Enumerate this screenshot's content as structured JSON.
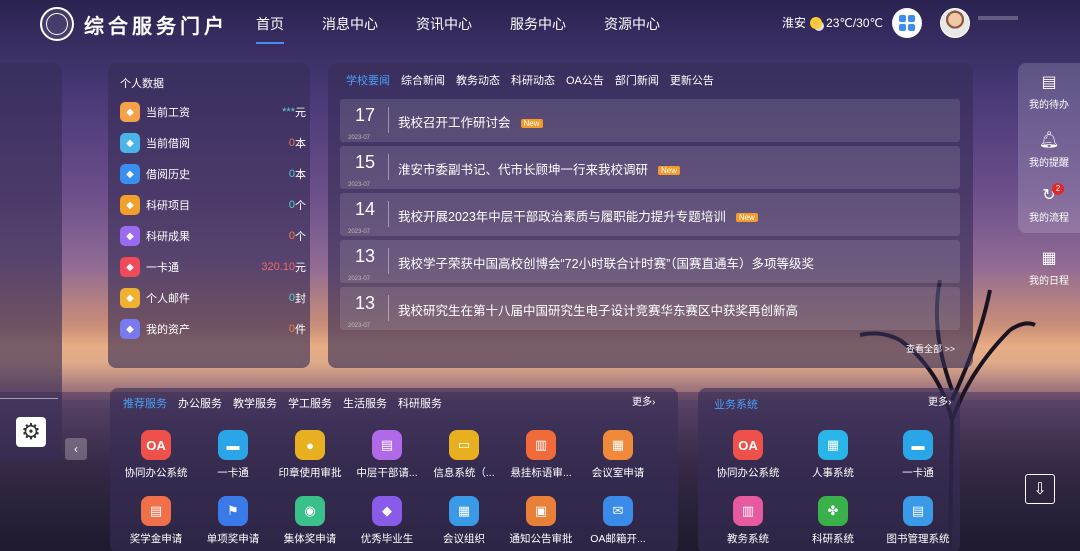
{
  "header": {
    "title": "综合服务门户",
    "nav": [
      "首页",
      "消息中心",
      "资讯中心",
      "服务中心",
      "资源中心"
    ],
    "weather_city": "淮安",
    "weather_temp": "23℃/30℃"
  },
  "personal": {
    "title": "个人数据",
    "items": [
      {
        "label": "当前工资",
        "value": "***",
        "unit": "元",
        "color": "#f5a14a"
      },
      {
        "label": "当前借阅",
        "value": "0",
        "unit": "本",
        "color": "#4ab3e8"
      },
      {
        "label": "借阅历史",
        "value": "0",
        "unit": "本",
        "color": "#3a8ef0"
      },
      {
        "label": "科研项目",
        "value": "0",
        "unit": "个",
        "color": "#f0a02a"
      },
      {
        "label": "科研成果",
        "value": "0",
        "unit": "个",
        "color": "#9a6af0"
      },
      {
        "label": "一卡通",
        "value": "320.10",
        "unit": "元",
        "color": "#f04a5a"
      },
      {
        "label": "个人邮件",
        "value": "0",
        "unit": "封",
        "color": "#f0b030"
      },
      {
        "label": "我的资产",
        "value": "0",
        "unit": "件",
        "color": "#7a7af0"
      }
    ]
  },
  "news": {
    "tabs": [
      "学校要闻",
      "综合新闻",
      "教务动态",
      "科研动态",
      "OA公告",
      "部门新闻",
      "更新公告"
    ],
    "items": [
      {
        "day": "17",
        "ym": "2023-07",
        "title": "我校召开工作研讨会",
        "new": "New"
      },
      {
        "day": "15",
        "ym": "2023-07",
        "title": "淮安市委副书记、代市长顾坤一行来我校调研",
        "new": "New"
      },
      {
        "day": "14",
        "ym": "2023-07",
        "title": "我校开展2023年中层干部政治素质与履职能力提升专题培训",
        "new": "New"
      },
      {
        "day": "13",
        "ym": "2023-07",
        "title": "我校学子荣获中国高校创博会“72小时联合计时赛”（国赛直通车）多项等级奖",
        "new": ""
      },
      {
        "day": "13",
        "ym": "2023-07",
        "title": "我校研究生在第十八届中国研究生电子设计竞赛华东赛区中获奖再创新高",
        "new": ""
      }
    ],
    "view_all": "查看全部 >>"
  },
  "rail": {
    "todo": "我的待办",
    "remind": "我的提醒",
    "flow": "我的流程",
    "flow_count": "2",
    "schedule": "我的日程"
  },
  "services": {
    "tabs": [
      "推荐服务",
      "办公服务",
      "教学服务",
      "学工服务",
      "生活服务",
      "科研服务"
    ],
    "more": "更多",
    "apps": [
      {
        "label": "协同办公系统",
        "icon": "OA",
        "color": "#f0504a"
      },
      {
        "label": "一卡通",
        "icon": "▬",
        "color": "#2aa5e8"
      },
      {
        "label": "印章使用审批",
        "icon": "●",
        "color": "#e8b020"
      },
      {
        "label": "中层干部请...",
        "icon": "▤",
        "color": "#b06ae8"
      },
      {
        "label": "信息系统（...",
        "icon": "▭",
        "color": "#e8b020"
      },
      {
        "label": "悬挂标语审...",
        "icon": "▥",
        "color": "#f06a3a"
      },
      {
        "label": "会议室申请",
        "icon": "▦",
        "color": "#f08a3a"
      },
      {
        "label": "奖学金申请",
        "icon": "▤",
        "color": "#f0704a"
      },
      {
        "label": "单项奖申请",
        "icon": "⚑",
        "color": "#3a7ae8"
      },
      {
        "label": "集体奖申请",
        "icon": "◉",
        "color": "#3ac08a"
      },
      {
        "label": "优秀毕业生",
        "icon": "◆",
        "color": "#8a5ae8"
      },
      {
        "label": "会议组织",
        "icon": "▦",
        "color": "#3a9ae8"
      },
      {
        "label": "通知公告审批",
        "icon": "▣",
        "color": "#e8803a"
      },
      {
        "label": "OA邮箱开...",
        "icon": "✉",
        "color": "#3a8ae8"
      }
    ]
  },
  "business": {
    "title": "业务系统",
    "more": "更多",
    "apps": [
      {
        "label": "协同办公系统",
        "icon": "OA",
        "color": "#f0504a"
      },
      {
        "label": "人事系统",
        "icon": "▦",
        "color": "#2ab5e8"
      },
      {
        "label": "一卡通",
        "icon": "▬",
        "color": "#2aa5e8"
      },
      {
        "label": "教务系统",
        "icon": "▥",
        "color": "#e85aa0"
      },
      {
        "label": "科研系统",
        "icon": "✤",
        "color": "#3ab04a"
      },
      {
        "label": "图书管理系统",
        "icon": "▤",
        "color": "#3a9ae8"
      }
    ]
  }
}
